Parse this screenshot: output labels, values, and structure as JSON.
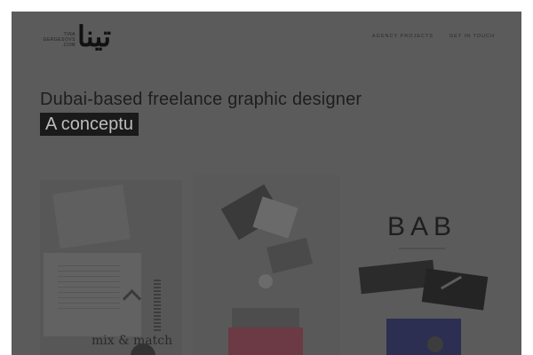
{
  "brand": {
    "logo_latin": "TINA\nGERGESOVS\n.COM",
    "logo_arabic": "تينا"
  },
  "nav": {
    "items": [
      {
        "label": "AGENCY PROJECTS"
      },
      {
        "label": "GET IN TOUCH"
      }
    ]
  },
  "hero": {
    "headline": "Dubai-based freelance graphic designer",
    "typing_text": "A conceptu"
  },
  "portfolio": {
    "cards": [
      {
        "mark_text": "mix & match"
      },
      {
        "mark_text": ""
      },
      {
        "mark_text": "BAB"
      }
    ]
  },
  "colors": {
    "overlay": "#5b5b5b",
    "typing_bg": "#1a1a1a",
    "text_dark": "#1e1e1e"
  }
}
